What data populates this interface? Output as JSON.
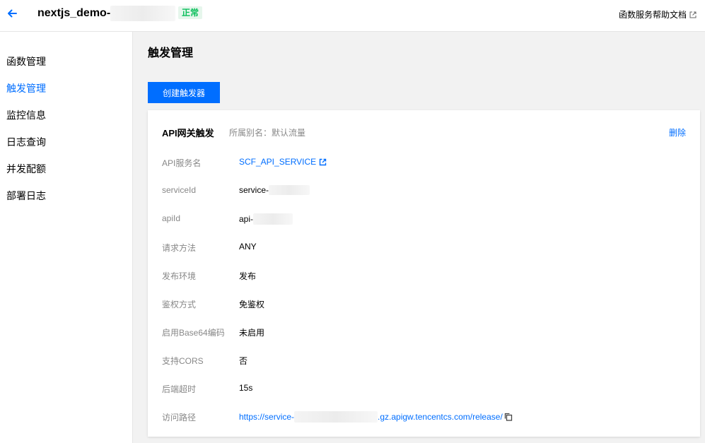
{
  "header": {
    "function_name": "nextjs_demo-",
    "status": "正常",
    "help_link": "函数服务帮助文档"
  },
  "sidebar": {
    "items": [
      {
        "label": "函数管理"
      },
      {
        "label": "触发管理"
      },
      {
        "label": "监控信息"
      },
      {
        "label": "日志查询"
      },
      {
        "label": "并发配额"
      },
      {
        "label": "部署日志"
      }
    ],
    "active_index": 1
  },
  "main": {
    "title": "触发管理",
    "create_button": "创建触发器"
  },
  "trigger": {
    "title": "API网关触发",
    "alias": "所属别名：默认流量",
    "delete_label": "删除",
    "fields": [
      {
        "label": "API服务名",
        "value": "SCF_API_SERVICE"
      },
      {
        "label": "serviceId",
        "value": "service-"
      },
      {
        "label": "apiId",
        "value": "api-"
      },
      {
        "label": "请求方法",
        "value": "ANY"
      },
      {
        "label": "发布环境",
        "value": "发布"
      },
      {
        "label": "鉴权方式",
        "value": "免鉴权"
      },
      {
        "label": "启用Base64编码",
        "value": "未启用"
      },
      {
        "label": "支持CORS",
        "value": "否"
      },
      {
        "label": "后端超时",
        "value": "15s"
      },
      {
        "label": "访问路径",
        "value": "https://service-",
        "suffix": ".gz.apigw.tencentcs.com/release/"
      }
    ]
  },
  "colors": {
    "accent": "#006eff",
    "status_green": "#0abf5b"
  }
}
